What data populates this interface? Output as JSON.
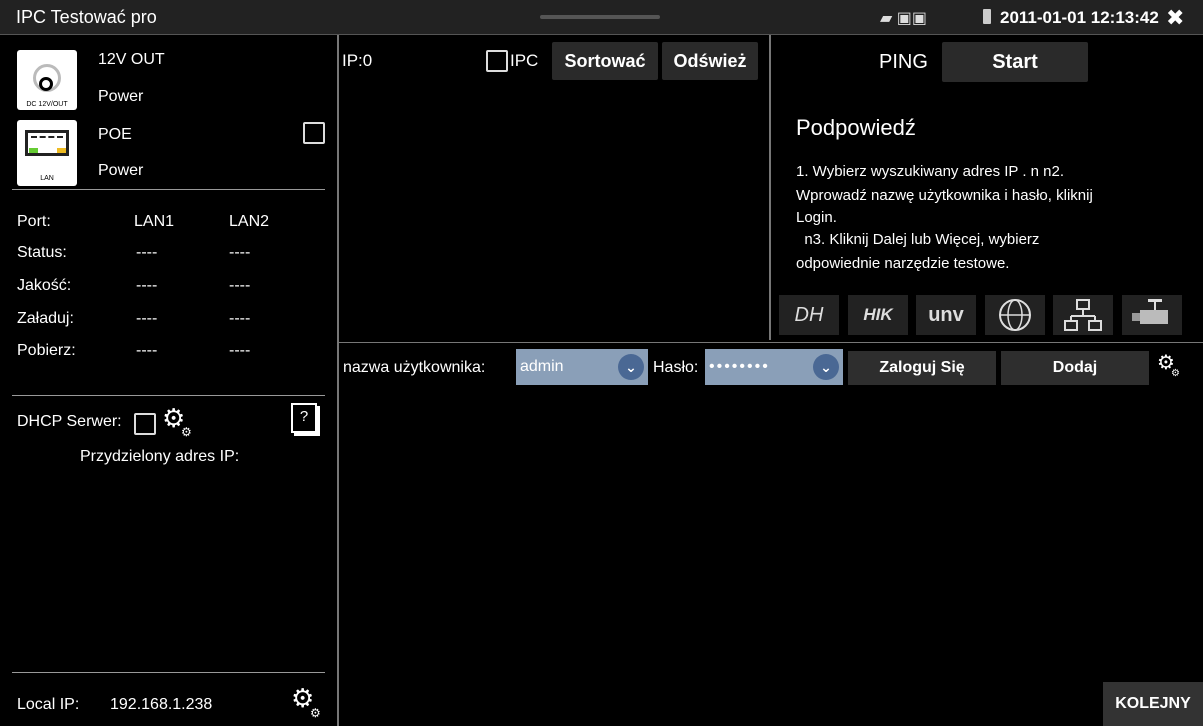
{
  "titlebar": {
    "app_title": "IPC Testować pro",
    "datetime": "2011-01-01 12:13:42",
    "close_symbol": "✖",
    "status_icons": "▰ ▣▣"
  },
  "left": {
    "dc_icon_caption": "DC 12V/OUT",
    "dc_label": "12V OUT",
    "dc_power": "Power",
    "lan_icon_caption": "LAN",
    "poe_label": "POE",
    "poe_power": "Power",
    "port_table": {
      "headers": [
        "Port:",
        "LAN1",
        "LAN2"
      ],
      "rows": [
        {
          "label": "Status:",
          "lan1": "----",
          "lan2": "----"
        },
        {
          "label": "Jakość:",
          "lan1": "----",
          "lan2": "----"
        },
        {
          "label": "Załaduj:",
          "lan1": "----",
          "lan2": "----"
        },
        {
          "label": "Pobierz:",
          "lan1": "----",
          "lan2": "----"
        }
      ]
    },
    "dhcp_label": "DHCP Serwer:",
    "help_symbol": "?",
    "assigned_ip_label": "Przydzielony adres IP:",
    "local_ip_label": "Local IP:",
    "local_ip_value": "192.168.1.238"
  },
  "middle": {
    "ip_count": "IP:0",
    "ipc_label": "IPC",
    "sort_button": "Sortować",
    "refresh_button": "Odśwież"
  },
  "ping": {
    "label": "PING",
    "start_button": "Start",
    "hint_title": "Podpowiedź",
    "hint_text_1": "1. Wybierz wyszukiwany adres IP .  n  n2.",
    "hint_text_2": "Wprowadź nazwę użytkownika i hasło, kliknij",
    "hint_text_3": "Login.",
    "hint_text_4": "  n3. Kliknij Dalej lub Więcej, wybierz",
    "hint_text_5": "odpowiednie narzędzie testowe.",
    "brands": [
      "DH",
      "HIK",
      "unv",
      "globe-icon",
      "network-icon",
      "camera-icon"
    ]
  },
  "login": {
    "username_label": "nazwa użytkownika:",
    "username_value": "admin",
    "password_label": "Hasło:",
    "password_value": "••••••••",
    "login_button": "Zaloguj Się",
    "add_button": "Dodaj"
  },
  "footer": {
    "next_button": "KOLEJNY"
  },
  "colors": {
    "background": "#000000",
    "select_bg": "#8a9fb8",
    "chevron_bg": "#4a6894",
    "button_bg": "#2a2a2a"
  }
}
